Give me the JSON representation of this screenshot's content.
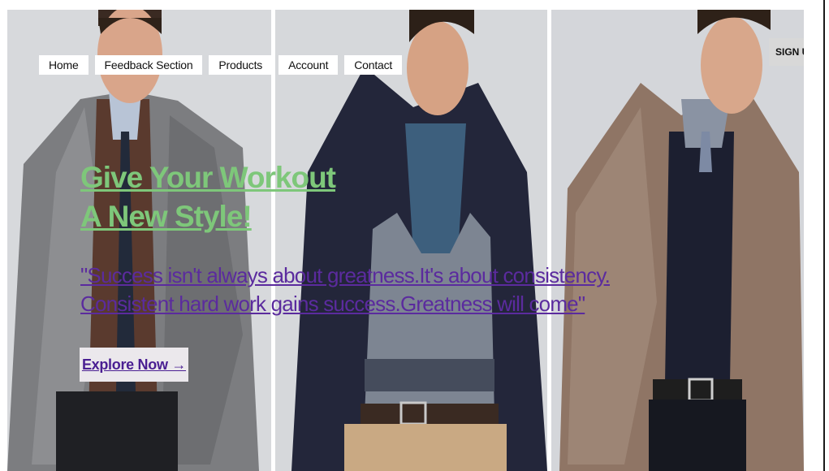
{
  "nav": {
    "items": [
      {
        "label": "Home"
      },
      {
        "label": "Feedback Section"
      },
      {
        "label": "Products"
      },
      {
        "label": "Account"
      },
      {
        "label": "Contact"
      }
    ]
  },
  "signup": {
    "label": "SIGN U"
  },
  "hero": {
    "headline_line1": "Give Your Workout",
    "headline_line2": "A New Style!",
    "quote_line1": "\"Success isn't always about greatness.It's about consistency.",
    "quote_line2": "Consistent hard work gains success.Greatness will come\"",
    "cta_label": "Explore Now →"
  },
  "colors": {
    "headline": "#7ec77a",
    "quote": "#5b2b9e",
    "cta_text": "#4a1f92",
    "cta_bg": "#ebe8ec",
    "signup_bg": "#d8d8d8"
  }
}
